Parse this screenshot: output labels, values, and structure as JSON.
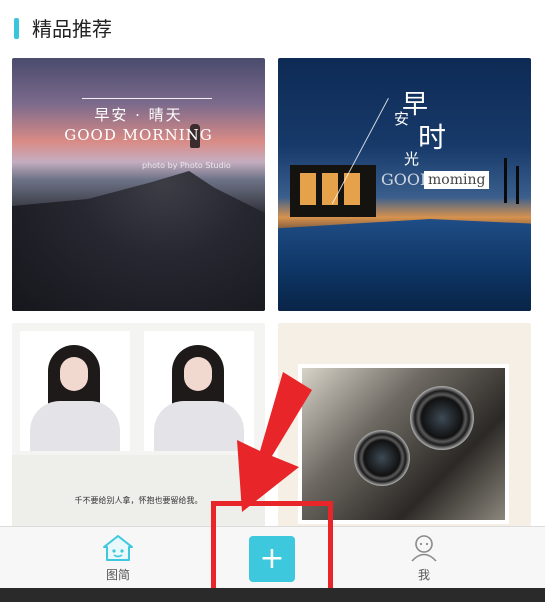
{
  "section": {
    "title": "精品推荐"
  },
  "cards": [
    {
      "id": "card-1",
      "title": "早安 · 晴天",
      "subtitle": "GOOD MORNING",
      "credit": "photo by Photo Studio"
    },
    {
      "id": "card-2",
      "title_chars": [
        "早",
        "安",
        "时",
        "光"
      ],
      "subtitle_left": "GOOD",
      "subtitle_right": "moming"
    },
    {
      "id": "card-3",
      "quote": "千不要给别人拿，怀抱也要留给我。"
    },
    {
      "id": "card-4"
    }
  ],
  "nav": {
    "left_label": "图简",
    "add_label": "+",
    "right_label": "我"
  },
  "colors": {
    "accent": "#3ec8de",
    "highlight": "#e8262a"
  },
  "icons": {
    "left": "house-face-icon",
    "add": "plus-icon",
    "right": "user-icon"
  }
}
